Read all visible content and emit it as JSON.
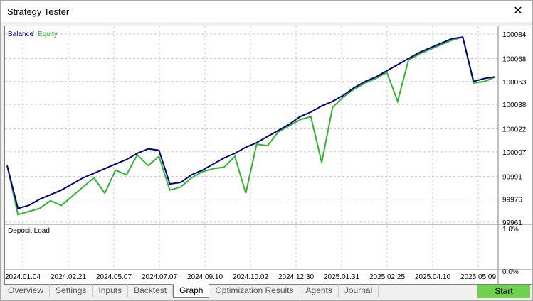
{
  "window": {
    "title": "Strategy Tester",
    "close_glyph": "✕"
  },
  "chart_data": {
    "type": "line",
    "legend": {
      "balance": "Balance",
      "separator": " / ",
      "equity": "Equity"
    },
    "colors": {
      "balance": "#00008b",
      "equity": "#2db82d",
      "grid": "#c8c8c8"
    },
    "y_ticks": [
      "100084",
      "100068",
      "100053",
      "100038",
      "100022",
      "100007",
      "99991",
      "99976",
      "99961"
    ],
    "ylim": [
      99961,
      100084
    ],
    "x_ticks": [
      "2024.01.04",
      "2024.02.21",
      "2024.05.07",
      "2024.07.07",
      "2024.09.10",
      "2024.10.02",
      "2024.12.30",
      "2025.01.31",
      "2025.02.25",
      "2025.04.10",
      "2025.05.09"
    ],
    "series": [
      {
        "name": "Balance",
        "values": [
          99998,
          99970,
          99972,
          99976,
          99979,
          99982,
          99986,
          99990,
          99993,
          99996,
          99999,
          100002,
          100006,
          100009,
          100008,
          99986,
          99987,
          99992,
          99995,
          99999,
          100003,
          100006,
          100010,
          100013,
          100017,
          100021,
          100025,
          100030,
          100033,
          100037,
          100040,
          100044,
          100049,
          100053,
          100056,
          100060,
          100064,
          100068,
          100072,
          100075,
          100078,
          100081,
          100082,
          100053,
          100055,
          100056
        ]
      },
      {
        "name": "Equity",
        "values": [
          99998,
          99966,
          99968,
          99970,
          99975,
          99972,
          99978,
          99984,
          99990,
          99980,
          99995,
          99992,
          100005,
          99998,
          100004,
          99982,
          99984,
          99990,
          99994,
          99996,
          99997,
          100004,
          99980,
          100012,
          100011,
          100020,
          100024,
          100028,
          100030,
          100000,
          100036,
          100043,
          100048,
          100052,
          100055,
          100059,
          100040,
          100067,
          100071,
          100074,
          100077,
          100080,
          100082,
          100052,
          100053,
          100056
        ]
      }
    ],
    "deposit_load": {
      "label": "Deposit Load",
      "ticks": [
        "1.0%",
        "0.0%"
      ]
    }
  },
  "tabs": [
    {
      "label": "Overview",
      "active": false
    },
    {
      "label": "Settings",
      "active": false
    },
    {
      "label": "Inputs",
      "active": false
    },
    {
      "label": "Backtest",
      "active": false
    },
    {
      "label": "Graph",
      "active": true
    },
    {
      "label": "Optimization Results",
      "active": false
    },
    {
      "label": "Agents",
      "active": false
    },
    {
      "label": "Journal",
      "active": false
    }
  ],
  "start_button": {
    "label": "Start"
  }
}
